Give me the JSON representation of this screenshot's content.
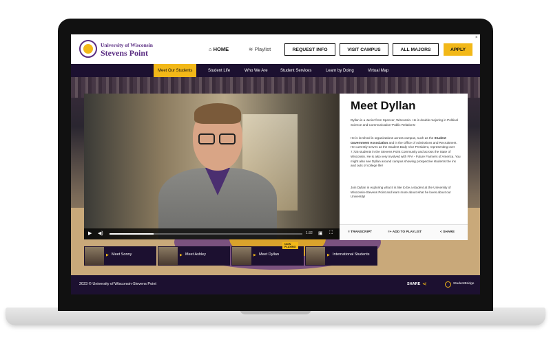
{
  "header": {
    "uni_line1": "University of Wisconsin",
    "uni_line2": "Stevens Point",
    "home": "HOME",
    "playlist": "Playlist",
    "request_info": "REQUEST INFO",
    "visit_campus": "VISIT CAMPUS",
    "all_majors": "ALL MAJORS",
    "apply": "APPLY",
    "close": "×"
  },
  "nav": {
    "items": [
      "Meet Our Students",
      "Student Life",
      "Who We Are",
      "Student Services",
      "Learn by Doing",
      "Virtual Map"
    ],
    "active_index": 0
  },
  "video": {
    "time": "1:32",
    "progress": 0.23
  },
  "info": {
    "title": "Meet Dyllan",
    "para1": "Dyllan is a Junior from Spencer, Wisconsin. He is double majoring in Political Science and Communication-Public Relations!",
    "para2_pre": "He is involved in organizations across campus, such as the ",
    "para2_bold": "Student Government Association",
    "para2_post": " and in the Office of Admissions and Recruitment. He currently serves as the Student Body Vice President, representing over 7,725 students in the Stevens Point Community and across the State of Wisconsin. He is also very involved with FFA - Future Farmers of America. You might also see Dyllan around campus showing prospective students the ins and outs of college life!",
    "para3": "Join Dyllan in exploring what it is like to be a student at the University of Wisconsin-Stevens Point and learn more about what he loves about our University!",
    "transcript": "TRANSCRIPT",
    "add_playlist": "ADD TO PLAYLIST",
    "share": "SHARE"
  },
  "thumbs": {
    "now_playing": "NOW PLAYING",
    "items": [
      {
        "label": "Meet Sonny"
      },
      {
        "label": "Meet Ashley"
      },
      {
        "label": "Meet Dyllan"
      },
      {
        "label": "International Students"
      }
    ]
  },
  "footer": {
    "copyright": "2023 © University of Wisconsin-Stevens Point",
    "share": "SHARE",
    "brand": "StudentBridge"
  },
  "colors": {
    "brand_purple": "#5a2d82",
    "accent_gold": "#f2b818",
    "nav_dark": "#1c1030"
  }
}
